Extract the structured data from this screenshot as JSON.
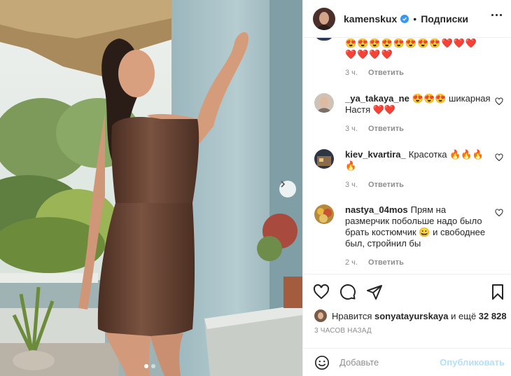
{
  "post": {
    "username": "kamenskux",
    "separator": "•",
    "follow_label": "Подписки",
    "verified_icon": "verified-badge-icon",
    "more_icon": "more-options-icon"
  },
  "carousel": {
    "next_icon": "chevron-right-icon",
    "current_slide": 1,
    "total_slides": 2
  },
  "comments": {
    "first_comment": {
      "emoji_line1": "😍😍😍😍😍😍😍😍❤️❤️❤️",
      "emoji_line2": "❤️❤️❤️❤️",
      "time": "3 ч.",
      "reply": "Ответить"
    },
    "items": [
      {
        "user": "_ya_takaya_ne",
        "text": "😍😍😍 шикарная Настя ❤️❤️",
        "time": "3 ч.",
        "reply": "Ответить"
      },
      {
        "user": "kiev_kvartira_",
        "text": "Красотка 🔥🔥🔥🔥",
        "time": "3 ч.",
        "reply": "Ответить"
      },
      {
        "user": "nastya_04mos",
        "text": "Прям на размерчик побольше надо было брать костюмчик 😀 и свободнее был, стройнил бы",
        "time": "2 ч.",
        "reply": "Ответить"
      }
    ]
  },
  "likes": {
    "prefix": "Нравится",
    "user": "sonyatayurskaya",
    "middle": "и ещё",
    "count": "32 828"
  },
  "timestamp": "3 ЧАСОВ НАЗАД",
  "add_comment": {
    "placeholder": "Добавьте",
    "publish": "Опубликовать"
  },
  "colors": {
    "accent": "#3897f0",
    "publish_disabled": "#b2dffc",
    "meta_gray": "#8e8e8e",
    "text": "#262626"
  }
}
